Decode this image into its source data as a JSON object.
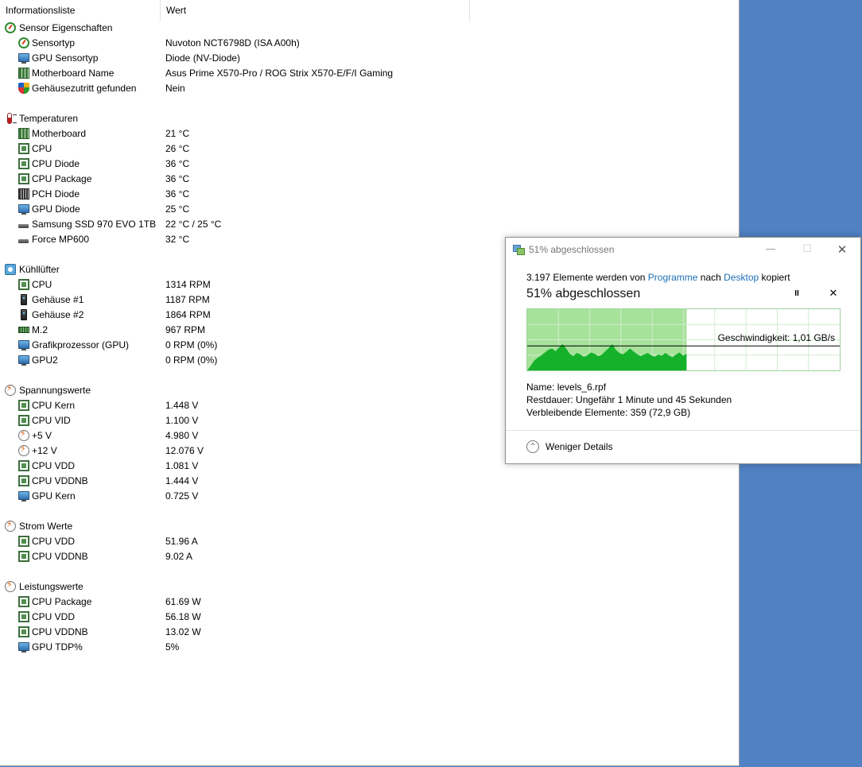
{
  "list": {
    "columns": {
      "item": "Informationsliste",
      "value": "Wert"
    },
    "groups": [
      {
        "title": "Sensor Eigenschaften",
        "icon": "gauge-icon",
        "items": [
          {
            "label": "Sensortyp",
            "value": "Nuvoton NCT6798D  (ISA A00h)",
            "icon": "gauge-icon"
          },
          {
            "label": "GPU Sensortyp",
            "value": "Diode  (NV-Diode)",
            "icon": "monitor-icon"
          },
          {
            "label": "Motherboard Name",
            "value": "Asus Prime X570-Pro / ROG Strix X570-E/F/I Gaming",
            "icon": "motherboard-icon"
          },
          {
            "label": "Gehäusezutritt gefunden",
            "value": "Nein",
            "icon": "shield-icon"
          }
        ]
      },
      {
        "title": "Temperaturen",
        "icon": "thermometer-icon",
        "items": [
          {
            "label": "Motherboard",
            "value": "21 °C",
            "icon": "motherboard-icon"
          },
          {
            "label": "CPU",
            "value": "26 °C",
            "icon": "chip-icon"
          },
          {
            "label": "CPU Diode",
            "value": "36 °C",
            "icon": "chip-icon"
          },
          {
            "label": "CPU Package",
            "value": "36 °C",
            "icon": "chip-icon"
          },
          {
            "label": "PCH Diode",
            "value": "36 °C",
            "icon": "pch-icon"
          },
          {
            "label": "GPU Diode",
            "value": "25 °C",
            "icon": "monitor-icon"
          },
          {
            "label": "Samsung SSD 970 EVO 1TB",
            "value": "22 °C / 25 °C",
            "icon": "ssd-icon"
          },
          {
            "label": "Force MP600",
            "value": "32 °C",
            "icon": "ssd-icon"
          }
        ]
      },
      {
        "title": "Kühllüfter",
        "icon": "fan-icon",
        "items": [
          {
            "label": "CPU",
            "value": "1314 RPM",
            "icon": "chip-icon"
          },
          {
            "label": "Gehäuse #1",
            "value": "1187 RPM",
            "icon": "case-icon"
          },
          {
            "label": "Gehäuse #2",
            "value": "1864 RPM",
            "icon": "case-icon"
          },
          {
            "label": "M.2",
            "value": "967 RPM",
            "icon": "ram-icon"
          },
          {
            "label": "Grafikprozessor (GPU)",
            "value": "0 RPM  (0%)",
            "icon": "monitor-icon"
          },
          {
            "label": "GPU2",
            "value": "0 RPM  (0%)",
            "icon": "monitor-icon"
          }
        ]
      },
      {
        "title": "Spannungswerte",
        "icon": "bolt-icon",
        "items": [
          {
            "label": "CPU Kern",
            "value": "1.448 V",
            "icon": "chip-icon"
          },
          {
            "label": "CPU VID",
            "value": "1.100 V",
            "icon": "chip-icon"
          },
          {
            "label": "+5 V",
            "value": "4.980 V",
            "icon": "bolt-icon"
          },
          {
            "label": "+12 V",
            "value": "12.076 V",
            "icon": "bolt-icon"
          },
          {
            "label": "CPU VDD",
            "value": "1.081 V",
            "icon": "chip-icon"
          },
          {
            "label": "CPU VDDNB",
            "value": "1.444 V",
            "icon": "chip-icon"
          },
          {
            "label": "GPU Kern",
            "value": "0.725 V",
            "icon": "monitor-icon"
          }
        ]
      },
      {
        "title": "Strom Werte",
        "icon": "bolt-icon",
        "items": [
          {
            "label": "CPU VDD",
            "value": "51.96 A",
            "icon": "chip-icon"
          },
          {
            "label": "CPU VDDNB",
            "value": "9.02 A",
            "icon": "chip-icon"
          }
        ]
      },
      {
        "title": "Leistungswerte",
        "icon": "bolt-icon",
        "items": [
          {
            "label": "CPU Package",
            "value": "61.69 W",
            "icon": "chip-icon"
          },
          {
            "label": "CPU VDD",
            "value": "56.18 W",
            "icon": "chip-icon"
          },
          {
            "label": "CPU VDDNB",
            "value": "13.02 W",
            "icon": "chip-icon"
          },
          {
            "label": "GPU TDP%",
            "value": "5%",
            "icon": "monitor-icon"
          }
        ]
      }
    ]
  },
  "dialog": {
    "title": "51% abgeschlossen",
    "summary": {
      "prefix": "3.197 Elemente werden von ",
      "source": "Programme",
      "middle": " nach ",
      "destination": "Desktop",
      "suffix": " kopiert"
    },
    "heading": "51% abgeschlossen",
    "progress_percent": 51,
    "speed_label": "Geschwindigkeit: 1,01 GB/s",
    "speed_profile": [
      0,
      0.12,
      0.25,
      0.32,
      0.38,
      0.45,
      0.52,
      0.55,
      0.48,
      0.58,
      0.66,
      0.55,
      0.42,
      0.36,
      0.44,
      0.4,
      0.34,
      0.38,
      0.45,
      0.42,
      0.36,
      0.39,
      0.48,
      0.56,
      0.66,
      0.52,
      0.44,
      0.4,
      0.47,
      0.55,
      0.48,
      0.41,
      0.36,
      0.4,
      0.44,
      0.38,
      0.34,
      0.4,
      0.37,
      0.44,
      0.38,
      0.33,
      0.4,
      0.45,
      0.37,
      0.42
    ],
    "speed_level": 0.5,
    "details": [
      {
        "key": "Name:",
        "value": "levels_6.rpf"
      },
      {
        "key": "Restdauer:",
        "value": "Ungefähr 1 Minute und 45 Sekunden"
      },
      {
        "key": "Verbleibende Elemente:",
        "value": "359 (72,9 GB)"
      }
    ],
    "less_details": "Weniger Details",
    "buttons": {
      "pause": "II",
      "cancel": "✕",
      "minimize": "—",
      "maximize": "☐",
      "close": "✕",
      "less_icon": "^"
    },
    "colors": {
      "graph_fill": "#a6e29a",
      "graph_area": "#15b12a",
      "graph_grid": "#d2ecd0",
      "link": "#1e6fb8"
    }
  }
}
